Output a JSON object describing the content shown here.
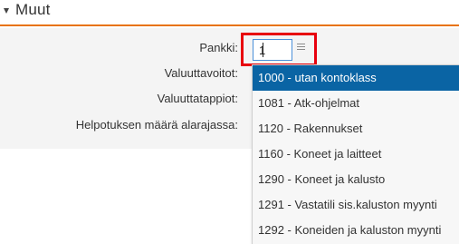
{
  "section": {
    "title": "Muut"
  },
  "form": {
    "pankki_label": "Pankki:",
    "pankki_value": "1",
    "valuuttavoitot_label": "Valuuttavoitot:",
    "valuuttatappiot_label": "Valuuttatappiot:",
    "helpotus_label": "Helpotuksen määrä alarajassa:"
  },
  "dropdown": {
    "items": [
      {
        "label": "1000 - utan kontoklass",
        "selected": true
      },
      {
        "label": "1081 - Atk-ohjelmat",
        "selected": false
      },
      {
        "label": "1120 - Rakennukset",
        "selected": false
      },
      {
        "label": "1160 - Koneet ja laitteet",
        "selected": false
      },
      {
        "label": "1290 - Koneet ja kalusto",
        "selected": false
      },
      {
        "label": "1291 - Vastatili sis.kaluston myynti",
        "selected": false
      },
      {
        "label": "1292 - Koneiden ja kaluston myynti",
        "selected": false
      }
    ]
  },
  "colors": {
    "accent": "#e8730c",
    "highlight_box": "#e8000e",
    "selected_item": "#0a64a4"
  },
  "icons": {
    "collapse": "triangle-down-icon",
    "lookup": "list-icon"
  }
}
